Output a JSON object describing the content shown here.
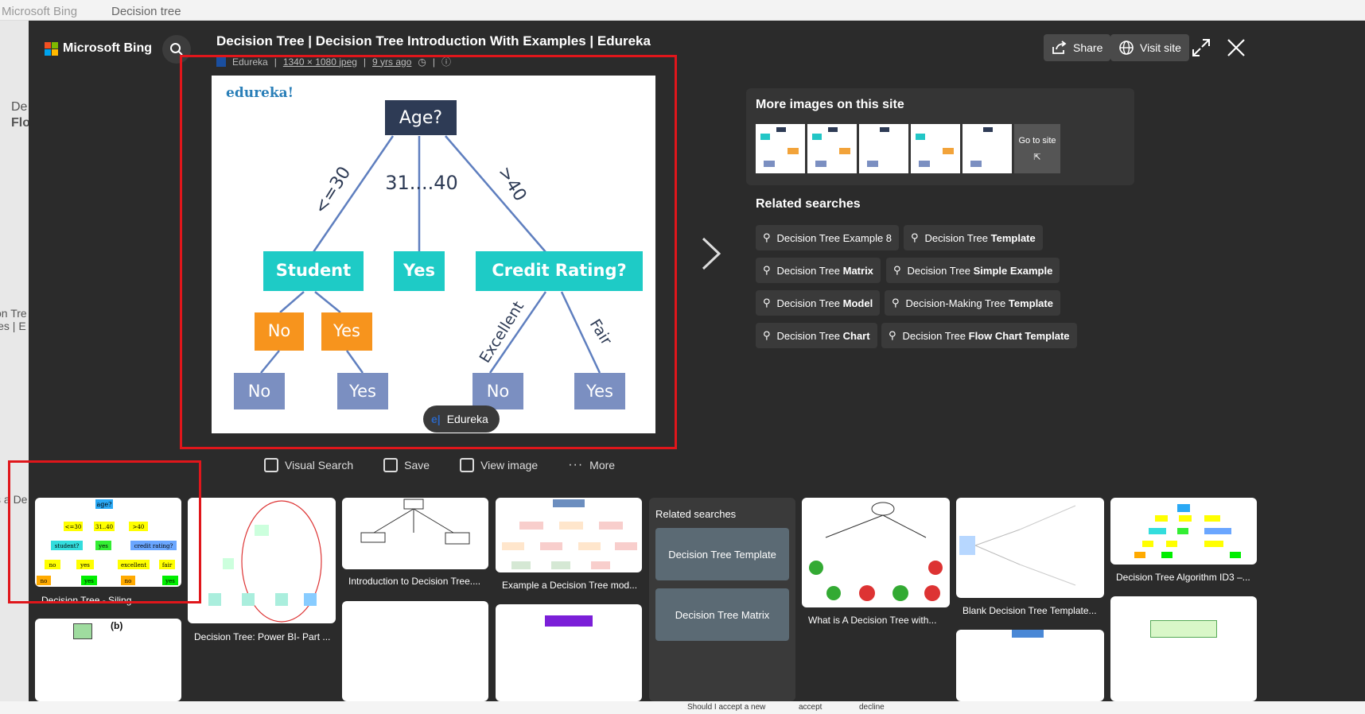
{
  "background": {
    "browser_tab": "Microsoft Bing",
    "search_query": "Decision tree",
    "left_snippets": [
      "De",
      "Flo",
      "on Tre",
      "les | E",
      "s a De"
    ],
    "bottom_text": [
      "Should I accept a new",
      "accept",
      "decline"
    ]
  },
  "header": {
    "brand": "Microsoft Bing",
    "title": "Decision Tree | Decision Tree Introduction With Examples | Edureka",
    "source": "Edureka",
    "dimensions": "1340 × 1080 jpeg",
    "age": "9 yrs ago",
    "share_label": "Share",
    "visit_label": "Visit site"
  },
  "main_image": {
    "watermark": "edureka!",
    "root": "Age?",
    "branch_left": "<=30",
    "branch_mid": "31....40",
    "branch_right": ">40",
    "node_student": "Student",
    "node_yes": "Yes",
    "node_credit": "Credit Rating?",
    "student_no": "No",
    "student_yes": "Yes",
    "leaf_no1": "No",
    "leaf_yes1": "Yes",
    "leaf_no2": "No",
    "leaf_yes2": "Yes",
    "edge_excellent": "Excellent",
    "edge_fair": "Fair",
    "attribution": "Edureka"
  },
  "actions": {
    "visual_search": "Visual Search",
    "save": "Save",
    "view_image": "View image",
    "more": "More"
  },
  "more_images": {
    "heading": "More images on this site",
    "go_to_site": "Go to site"
  },
  "related_searches": {
    "heading": "Related searches",
    "items": [
      {
        "plain": "Decision Tree Example 8",
        "bold": ""
      },
      {
        "plain": "Decision Tree ",
        "bold": "Template"
      },
      {
        "plain": "Decision Tree ",
        "bold": "Matrix"
      },
      {
        "plain": "Decision Tree ",
        "bold": "Simple Example"
      },
      {
        "plain": "Decision Tree ",
        "bold": "Model"
      },
      {
        "plain": "Decision-Making Tree ",
        "bold": "Template"
      },
      {
        "plain": "Decision Tree ",
        "bold": "Chart"
      },
      {
        "plain": "Decision Tree ",
        "bold": "Flow Chart Template"
      }
    ]
  },
  "strip": {
    "captions": [
      "Decision Tree - Siling",
      "Decision Tree: Power BI- Part ...",
      "Introduction to Decision Tree....",
      "Example a Decision Tree mod...",
      "What is A Decision Tree with...",
      "Blank Decision Tree Template...",
      "Decision Tree Algorithm ID3 –..."
    ],
    "related_heading": "Related searches",
    "related_items": [
      "Decision Tree Template",
      "Decision Tree Matrix"
    ],
    "thumb1_labels": [
      "age?",
      "<=30",
      "31..40",
      ">40",
      "student?",
      "yes",
      "credit rating?",
      "no",
      "yes",
      "excellent",
      "fair",
      "no",
      "yes",
      "no",
      "yes"
    ],
    "thumb2_label": "(b)"
  },
  "colors": {
    "overlay": "#2b2b2b",
    "red_highlight": "#e0161b",
    "teal": "#1ecbc6",
    "orange": "#f7941d",
    "navy": "#2e3b55",
    "slate": "#7b8fc1"
  }
}
